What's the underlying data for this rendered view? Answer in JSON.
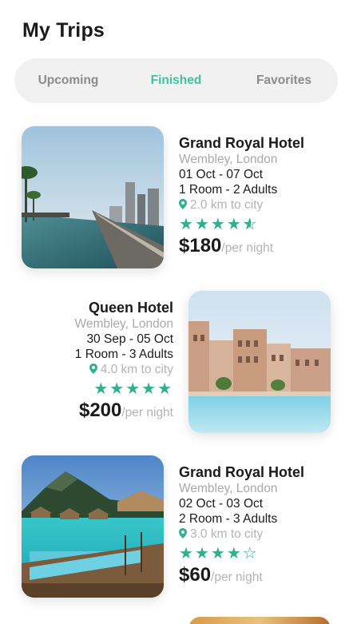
{
  "page": {
    "title": "My Trips"
  },
  "tabs": [
    {
      "label": "Upcoming",
      "active": false
    },
    {
      "label": "Finished",
      "active": true
    },
    {
      "label": "Favorites",
      "active": false
    }
  ],
  "colors": {
    "accent": "#3ec3a1",
    "star": "#2fb08f",
    "muted": "#a9a9a9",
    "tab_bg": "#f1f1f1"
  },
  "trips": [
    {
      "name": "Grand Royal Hotel",
      "location": "Wembley, London",
      "dates": "01 Oct - 07 Oct",
      "guests": "1 Room - 2 Adults",
      "distance": "2.0 km to city",
      "rating": 4.5,
      "price": "$180",
      "per": "/per night",
      "image": "infinity-pool-skyline"
    },
    {
      "name": "Queen Hotel",
      "location": "Wembley, London",
      "dates": "30 Sep - 05 Oct",
      "guests": "1 Room - 3 Adults",
      "distance": "4.0 km to city",
      "rating": 5,
      "price": "$200",
      "per": "/per night",
      "image": "resort-pool-palace"
    },
    {
      "name": "Grand Royal Hotel",
      "location": "Wembley, London",
      "dates": "02 Oct - 03 Oct",
      "guests": "2 Room - 3 Adults",
      "distance": "3.0 km to city",
      "rating": 4,
      "price": "$60",
      "per": "/per night",
      "image": "overwater-bungalows"
    }
  ]
}
